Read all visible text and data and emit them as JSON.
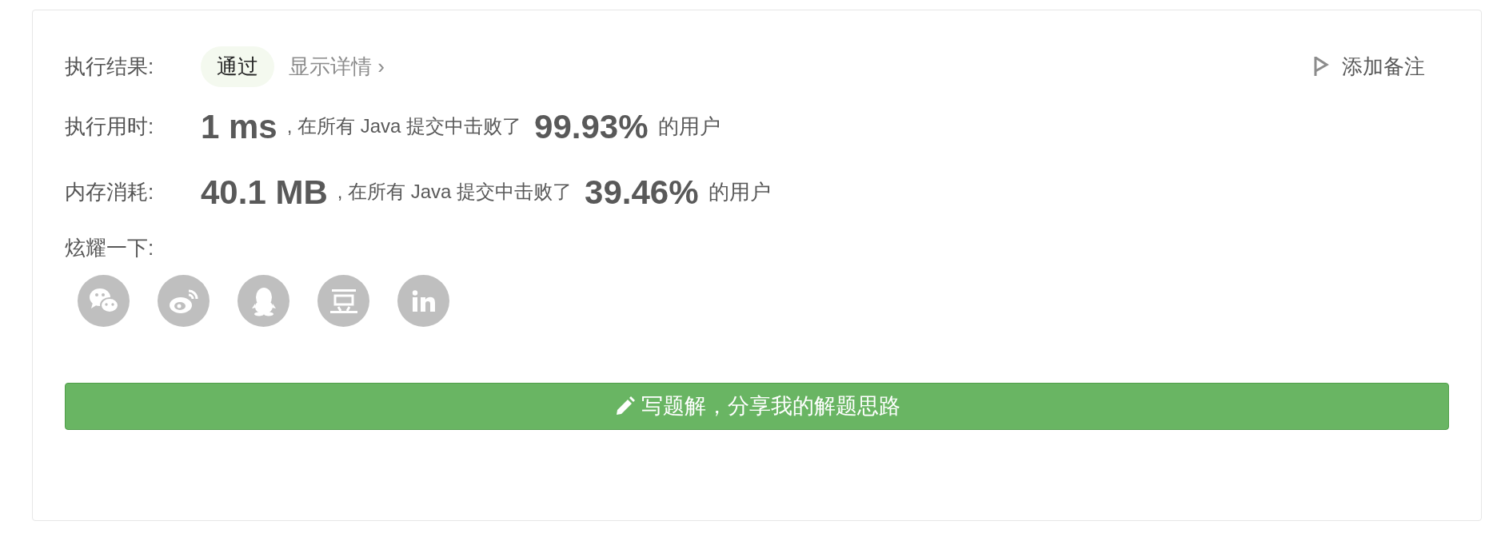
{
  "result": {
    "label": "执行结果:",
    "status": "通过",
    "details_link": "显示详情 ›"
  },
  "add_note": "添加备注",
  "stats": [
    {
      "label": "执行用时:",
      "value": "1 ms",
      "middle": ", 在所有 Java 提交中击败了",
      "percent": "99.93%",
      "suffix": "的用户"
    },
    {
      "label": "内存消耗:",
      "value": "40.1 MB",
      "middle": ", 在所有 Java 提交中击败了",
      "percent": "39.46%",
      "suffix": "的用户"
    }
  ],
  "share": {
    "label": "炫耀一下:"
  },
  "solution_button": "写题解，分享我的解题思路"
}
